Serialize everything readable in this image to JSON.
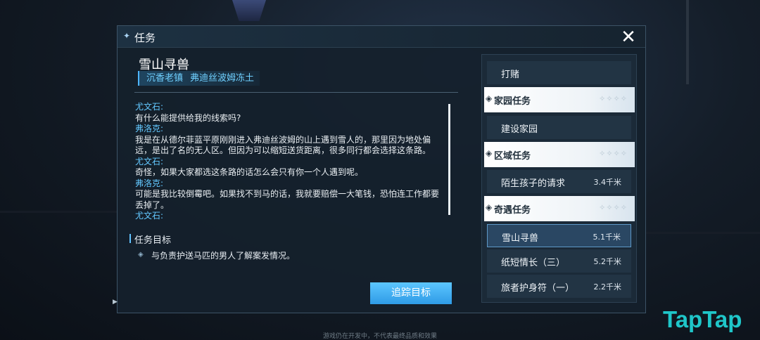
{
  "header": {
    "title": "任务"
  },
  "quest": {
    "title": "雪山寻兽",
    "locations": [
      "沉香老镇",
      "弗迪丝波姆冻土"
    ]
  },
  "dialog": [
    {
      "speaker": "尤文石:",
      "text": "有什么能提供给我的线索吗?"
    },
    {
      "speaker": "弗洛克:",
      "text": "我是在从德尔菲蓝平原刚刚进入弗迪丝波姆的山上遇到雪人的，那里因为地处偏远，是出了名的无人区。但因为可以缩短送货距离，很多同行都会选择这条路。"
    },
    {
      "speaker": "尤文石:",
      "text": "奇怪，如果大家都选这条路的话怎么会只有你一个人遇到呢。"
    },
    {
      "speaker": "弗洛克:",
      "text": "可能是我比较倒霉吧。如果找不到马的话，我就要赔偿一大笔钱，恐怕连工作都要丢掉了。"
    },
    {
      "speaker": "尤文石:",
      "text": ""
    }
  ],
  "objective": {
    "title": "任务目标",
    "text": "与负责护送马匹的男人了解案发情况。"
  },
  "track_button": "追踪目标",
  "sidebar": {
    "item_gamble": "打赌",
    "cat_home": "家园任务",
    "item_build": "建设家园",
    "cat_region": "区域任务",
    "item_child": {
      "label": "陌生孩子的请求",
      "dist": "3.4千米"
    },
    "cat_encounter": "奇遇任务",
    "item_snow": {
      "label": "雪山寻兽",
      "dist": "5.1千米"
    },
    "item_paper": {
      "label": "纸短情长（三）",
      "dist": "5.2千米"
    },
    "item_amulet": {
      "label": "旅者护身符（一）",
      "dist": "2.2千米"
    }
  },
  "watermark": "TapTap",
  "footer": "游戏仍在开发中，不代表最终品质和效果",
  "colors": {
    "accent": "#4db5ff",
    "button": "#3fa9f0",
    "speaker": "#63c8ff"
  }
}
